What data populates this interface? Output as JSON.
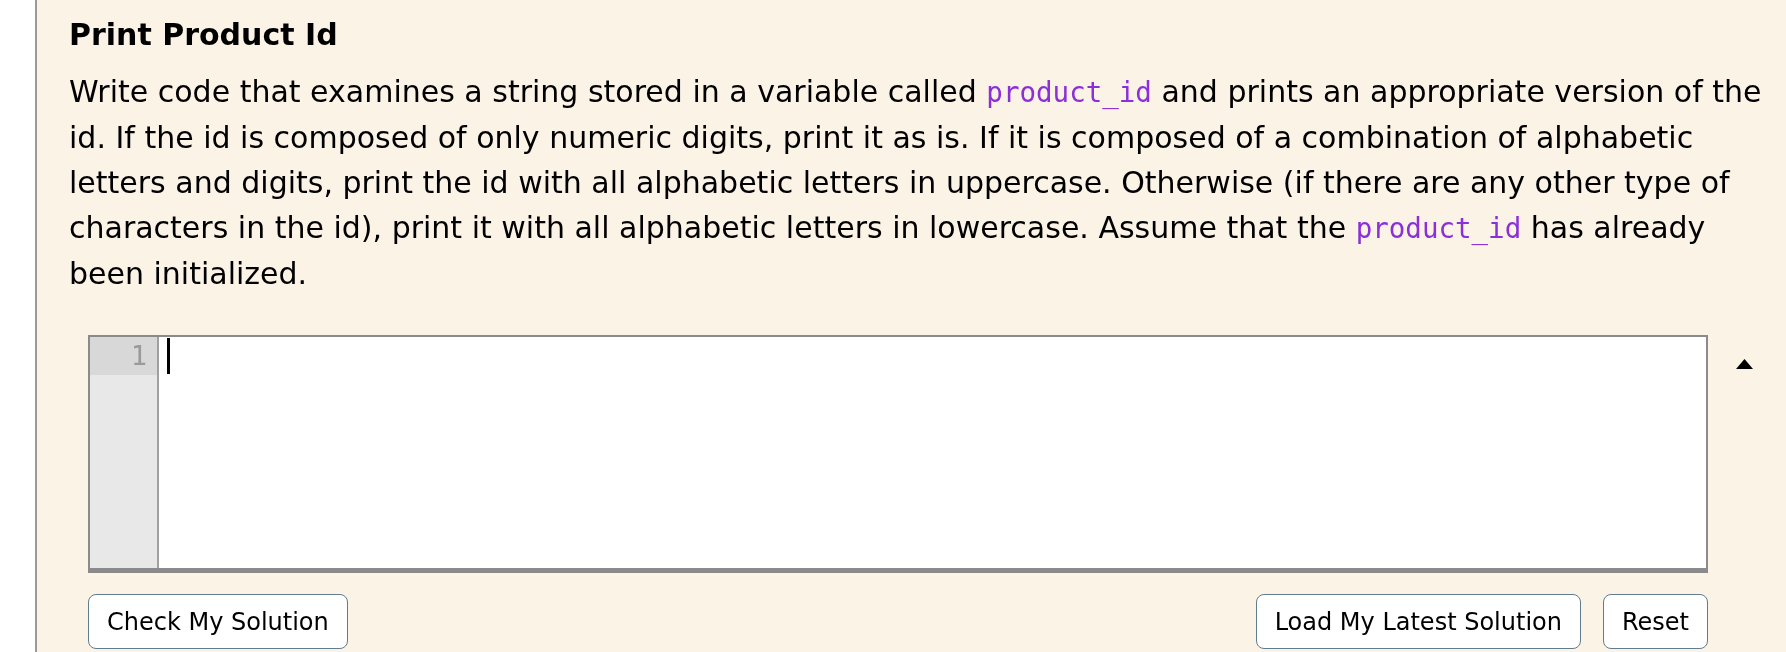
{
  "exercise": {
    "title": "Print Product Id",
    "description": [
      {
        "kind": "text",
        "text": "Write code that examines a string stored in a variable called "
      },
      {
        "kind": "code",
        "text": "product_id"
      },
      {
        "kind": "text",
        "text": " and prints an appropriate version of the id. If the id is composed of only numeric digits, print it as is. If it is composed of a combination of alphabetic letters and digits, print the id with all alphabetic letters in uppercase. Otherwise (if there are any other type of characters in the id), print it with all alphabetic letters in lowercase. Assume that the "
      },
      {
        "kind": "code",
        "text": "product_id"
      },
      {
        "kind": "text",
        "text": " has already been initialized."
      }
    ]
  },
  "editor": {
    "focused": true,
    "expanded": true,
    "lines": [
      {
        "number": "1",
        "active": true
      }
    ]
  },
  "left_buttons": [
    {
      "label": "Check My Solution"
    }
  ],
  "right_buttons": [
    {
      "label": "Load My Latest Solution"
    },
    {
      "label": "Reset"
    }
  ]
}
